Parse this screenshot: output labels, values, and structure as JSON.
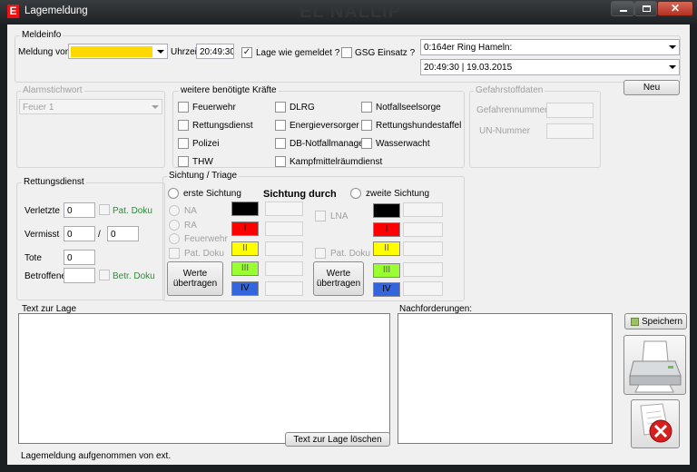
{
  "window": {
    "title": "Lagemeldung",
    "ghost_title": "EL NALLIP",
    "app_icon": "E"
  },
  "meldeinfo": {
    "group_label": "Meldeinfo",
    "meldung_von_label": "Meldung von",
    "meldung_von_value": "",
    "uhrzeit_label": "Uhrzeit",
    "uhrzeit_value": "20:49:30",
    "lage_wie_gemeldet_label": "Lage wie gemeldet ?",
    "lage_wie_gemeldet_checked": "✓",
    "gsg_einsatz_label": "GSG Einsatz ?",
    "location_select": "0:164er Ring Hameln:",
    "datetime_select": "20:49:30  |  19.03.2015",
    "neu_button": "Neu"
  },
  "alarm": {
    "group_label": "Alarmstichwort",
    "value": "Feuer 1"
  },
  "kraefte": {
    "group_label": "weitere benötigte Kräfte",
    "col1": [
      "Feuerwehr",
      "Rettungsdienst",
      "Polizei",
      "THW"
    ],
    "col2": [
      "DLRG",
      "Energieversorger",
      "DB-Notfallmanager",
      "Kampfmittelräumdienst"
    ],
    "col3": [
      "Notfallseelsorge",
      "Rettungshundestaffel",
      "Wasserwacht"
    ]
  },
  "gefahrstoff": {
    "group_label": "Gefahrstoffdaten",
    "gefahrennummer_label": "Gefahrennummer",
    "un_nummer_label": "UN-Nummer"
  },
  "rettungsdienst": {
    "group_label": "Rettungsdienst",
    "verletzte_label": "Verletzte",
    "verletzte_value": "0",
    "pat_doku_label": "Pat. Doku",
    "vermisst_label": "Vermisst",
    "vermisst_value1": "0",
    "separator": "/",
    "vermisst_value2": "0",
    "tote_label": "Tote",
    "tote_value": "0",
    "betroffene_label": "Betroffene",
    "betroffene_value": "",
    "betr_doku_label": "Betr. Doku"
  },
  "sichtung": {
    "group_label": "Sichtung / Triage",
    "erste_label": "erste Sichtung",
    "durch_label": "Sichtung durch",
    "zweite_label": "zweite Sichtung",
    "na_label": "NA",
    "ra_label": "RA",
    "feuerwehr_label": "Feuerwehr",
    "pat_doku_label": "Pat. Doku",
    "lna_label": "LNA",
    "pat_doku2_label": "Pat. Doku",
    "werte_button1": "Werte übertragen",
    "werte_button2": "Werte übertragen",
    "categories": [
      {
        "label": "",
        "color": "#000000",
        "text_color": "#ffffff"
      },
      {
        "label": "I",
        "color": "#ff0000",
        "text_color": "#000000"
      },
      {
        "label": "II",
        "color": "#ffff00",
        "text_color": "#555555"
      },
      {
        "label": "III",
        "color": "#99ff33",
        "text_color": "#555555"
      },
      {
        "label": "IV",
        "color": "#3366dd",
        "text_color": "#000000"
      }
    ]
  },
  "text_zur_lage": {
    "label": "Text zur Lage",
    "content": "",
    "clear_button": "Text zur Lage löschen"
  },
  "nachforderungen": {
    "label": "Nachforderungen:",
    "content": ""
  },
  "actions": {
    "speichern_button": "Speichern"
  },
  "status": {
    "text": "Lagemeldung aufgenommen von ext."
  }
}
